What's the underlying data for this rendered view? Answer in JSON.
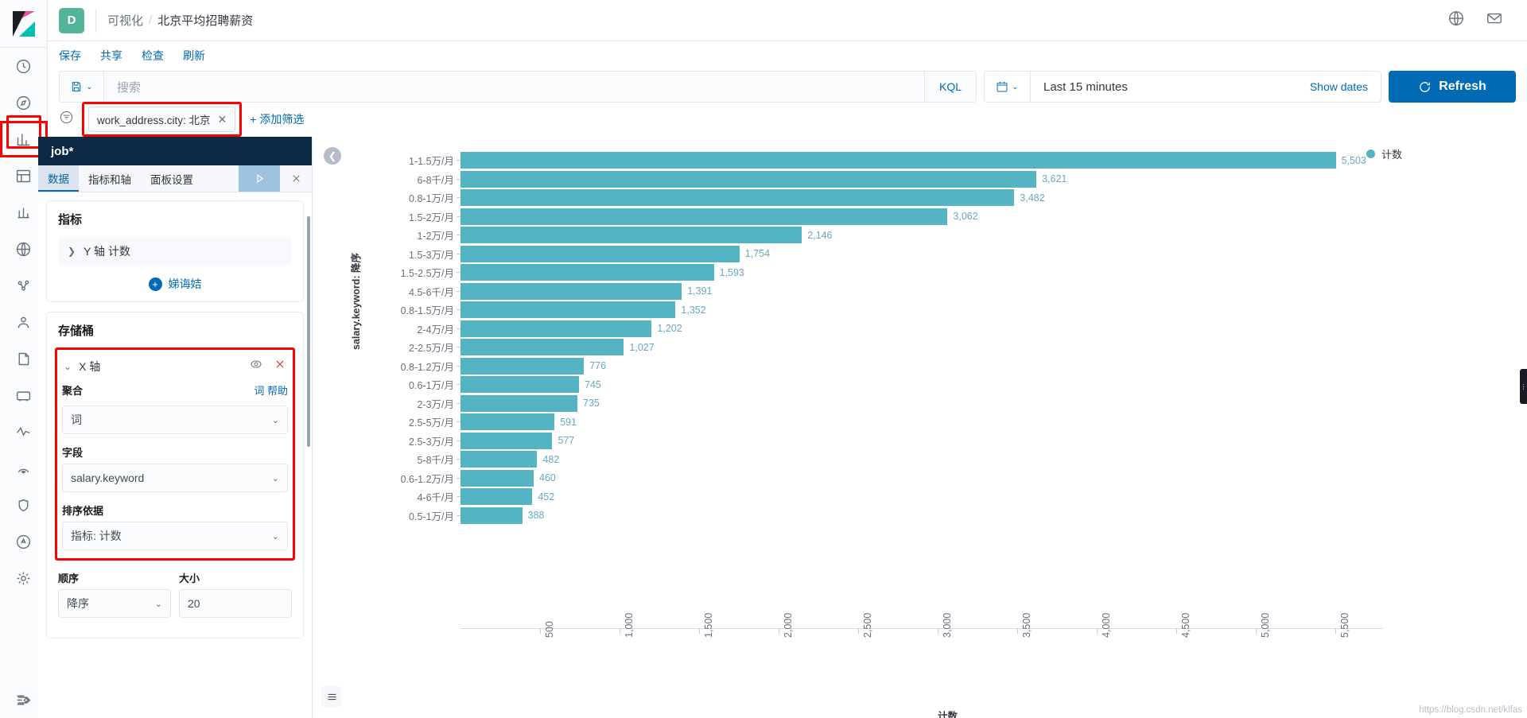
{
  "header": {
    "space_badge": "D",
    "breadcrumb_parent": "可视化",
    "breadcrumb_sep": "/",
    "breadcrumb_current": "北京平均招聘薪资"
  },
  "actions": [
    {
      "label": "保存",
      "name": "save-link"
    },
    {
      "label": "共享",
      "name": "share-link"
    },
    {
      "label": "检查",
      "name": "inspect-link"
    },
    {
      "label": "刷新",
      "name": "refresh-link"
    }
  ],
  "query": {
    "search_placeholder": "搜索",
    "language": "KQL",
    "date_range": "Last 15 minutes",
    "show_dates": "Show dates",
    "refresh_label": "Refresh"
  },
  "filters": {
    "pill_label": "work_address.city: 北京",
    "pill_close": "✕",
    "add_filter": "+ 添加筛选"
  },
  "editor": {
    "index_pattern": "job*",
    "tabs": [
      {
        "label": "数据",
        "selected": true
      },
      {
        "label": "指标和轴",
        "selected": false
      },
      {
        "label": "面板设置",
        "selected": false
      }
    ],
    "metrics": {
      "heading": "指标",
      "item": "Y 轴 计数",
      "add_label": "娣诲姞"
    },
    "buckets": {
      "heading": "存储桶",
      "axis_label": "X 轴",
      "aggregation_label": "聚合",
      "aggregation_help": "词 帮助",
      "aggregation_value": "词",
      "field_label": "字段",
      "field_value": "salary.keyword",
      "order_by_label": "排序依据",
      "order_by_value": "指标: 计数",
      "order_label": "顺序",
      "order_value": "降序",
      "size_label": "大小",
      "size_value": "20"
    }
  },
  "chart": {
    "legend_label": "计数",
    "watermark": "https://blog.csdn.net/klfas",
    "accent_color": "#54b4c4",
    "label_color": "#69a8c0"
  },
  "chart_data": {
    "type": "bar",
    "orientation": "horizontal",
    "title": "",
    "xlabel": "计数",
    "ylabel": "salary.keyword: 降序",
    "xlim": [
      0,
      5800
    ],
    "xticks": [
      500,
      1000,
      1500,
      2000,
      2500,
      3000,
      3500,
      4000,
      4500,
      5000,
      5500
    ],
    "xtick_labels": [
      "500",
      "1,000",
      "1,500",
      "2,000",
      "2,500",
      "3,000",
      "3,500",
      "4,000",
      "4,500",
      "5,000",
      "5,500"
    ],
    "grid": false,
    "legend": [
      "计数"
    ],
    "legend_position": "right",
    "categories": [
      "1-1.5万/月",
      "6-8千/月",
      "0.8-1万/月",
      "1.5-2万/月",
      "1-2万/月",
      "1.5-3万/月",
      "1.5-2.5万/月",
      "4.5-6千/月",
      "0.8-1.5万/月",
      "2-4万/月",
      "2-2.5万/月",
      "0.8-1.2万/月",
      "0.6-1万/月",
      "2-3万/月",
      "2.5-5万/月",
      "2.5-3万/月",
      "5-8千/月",
      "0.6-1.2万/月",
      "4-6千/月",
      "0.5-1万/月"
    ],
    "values": [
      5503,
      3621,
      3482,
      3062,
      2146,
      1754,
      1593,
      1391,
      1352,
      1202,
      1027,
      776,
      745,
      735,
      591,
      577,
      482,
      460,
      452,
      388
    ],
    "value_labels": [
      "5,503",
      "3,621",
      "3,482",
      "3,062",
      "2,146",
      "1,754",
      "1,593",
      "1,391",
      "1,352",
      "1,202",
      "1,027",
      "776",
      "745",
      "735",
      "591",
      "577",
      "482",
      "460",
      "452",
      "388"
    ]
  }
}
